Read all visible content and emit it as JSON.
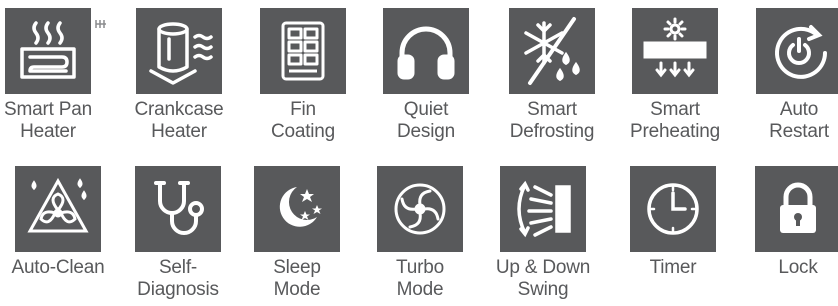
{
  "features": [
    {
      "id": "smart-pan-heater",
      "icon": "pan-heater-icon",
      "lines": [
        "Smart Pan",
        "Heater"
      ]
    },
    {
      "id": "crankcase-heater",
      "icon": "crankcase-heater-icon",
      "lines": [
        "Crankcase",
        "Heater"
      ]
    },
    {
      "id": "fin-coating",
      "icon": "fin-coating-icon",
      "lines": [
        "Fin",
        "Coating"
      ]
    },
    {
      "id": "quiet-design",
      "icon": "headphones-icon",
      "lines": [
        "Quiet",
        "Design"
      ]
    },
    {
      "id": "smart-defrosting",
      "icon": "snowflake-drop-icon",
      "lines": [
        "Smart",
        "Defrosting"
      ]
    },
    {
      "id": "smart-preheating",
      "icon": "preheating-icon",
      "lines": [
        "Smart",
        "Preheating"
      ]
    },
    {
      "id": "auto-restart",
      "icon": "power-restart-icon",
      "lines": [
        "Auto",
        "Restart"
      ]
    },
    {
      "id": "auto-clean",
      "icon": "fan-clean-icon",
      "lines": [
        "Auto-Clean"
      ]
    },
    {
      "id": "self-diagnosis",
      "icon": "stethoscope-icon",
      "lines": [
        "Self-",
        "Diagnosis"
      ]
    },
    {
      "id": "sleep-mode",
      "icon": "moon-stars-icon",
      "lines": [
        "Sleep",
        "Mode"
      ]
    },
    {
      "id": "turbo-mode",
      "icon": "turbo-fan-icon",
      "lines": [
        "Turbo",
        "Mode"
      ]
    },
    {
      "id": "up-down-swing",
      "icon": "swing-louver-icon",
      "lines": [
        "Up & Down",
        "Swing"
      ]
    },
    {
      "id": "timer",
      "icon": "clock-icon",
      "lines": [
        "Timer"
      ]
    },
    {
      "id": "lock",
      "icon": "padlock-icon",
      "lines": [
        "Lock"
      ]
    }
  ],
  "colors": {
    "tile": "#58595b",
    "label": "#58595b",
    "icon": "#ffffff",
    "background": "#ffffff"
  }
}
